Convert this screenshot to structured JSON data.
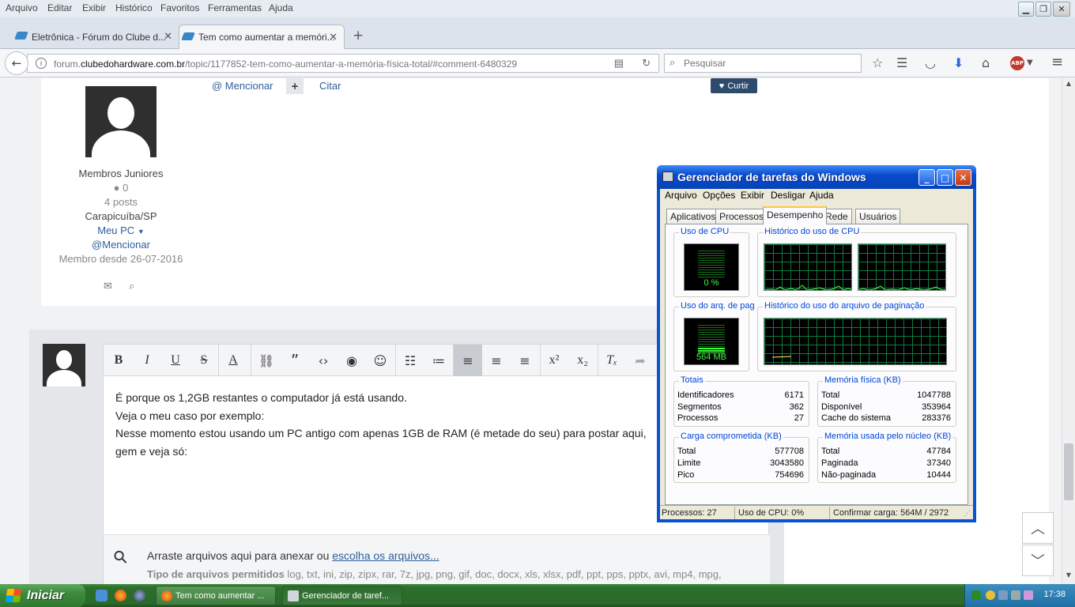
{
  "firefox": {
    "menu": [
      "Arquivo",
      "Editar",
      "Exibir",
      "Histórico",
      "Favoritos",
      "Ferramentas",
      "Ajuda"
    ],
    "tabs": [
      {
        "title": "Eletrônica - Fórum do Clube d...",
        "active": false
      },
      {
        "title": "Tem como aumentar a memóri...",
        "active": true
      }
    ],
    "url_pre": "forum.",
    "url_domain": "clubedohardware.com.br",
    "url_path": "/topic/1177852-tem-como-aumentar-a-memória-física-total/#comment-6480329",
    "search_placeholder": "Pesquisar"
  },
  "post": {
    "mention_action": "@ Mencionar",
    "quote_action": "Citar",
    "like_label": "Curtir",
    "author": {
      "group": "Membros Juniores",
      "reputation": "0",
      "posts": "4 posts",
      "location": "Carapicuíba/SP",
      "my_pc": "Meu PC",
      "mention": "@Mencionar",
      "member_since": "Membro desde 26-07-2016"
    }
  },
  "editor": {
    "lines": [
      "É porque os 1,2GB restantes o computador já está usando.",
      "Veja o meu caso por exemplo:",
      "Nesse momento estou usando um PC antigo com apenas 1GB de RAM (é metade do seu)  para postar aqui,",
      "gem e veja só:"
    ],
    "attach_text": "Arraste arquivos aqui para anexar ou ",
    "attach_link": "escolha os arquivos...",
    "filetypes_label": "Tipo de arquivos permitidos",
    "filetypes": " log, txt, ini, zip, zipx, rar, 7z, jpg, png, gif, doc, docx, xls, xlsx, pdf, ppt, pps, pptx, avi, mp4, mpg,"
  },
  "taskmgr": {
    "title": "Gerenciador de tarefas do Windows",
    "menu": [
      "Arquivo",
      "Opções",
      "Exibir",
      "Desligar",
      "Ajuda"
    ],
    "tabs": [
      "Aplicativos",
      "Processos",
      "Desempenho",
      "Rede",
      "Usuários"
    ],
    "active_tab": "Desempenho",
    "cpu_label": "Uso de CPU",
    "cpu_value": "0 %",
    "cpu_usage": 0,
    "cpu_hist_label": "Histórico do uso de CPU",
    "pf_label": "Uso do arq. de pag",
    "pf_value": "564 MB",
    "pf_usage": 0.19,
    "pf_hist_label": "Histórico do uso do arquivo de paginação",
    "totals": {
      "label": "Totais",
      "rows": [
        {
          "k": "Identificadores",
          "v": "6171"
        },
        {
          "k": "Segmentos",
          "v": "362"
        },
        {
          "k": "Processos",
          "v": "27"
        }
      ]
    },
    "physical": {
      "label": "Memória física (KB)",
      "rows": [
        {
          "k": "Total",
          "v": "1047788"
        },
        {
          "k": "Disponível",
          "v": "353964"
        },
        {
          "k": "Cache do sistema",
          "v": "283376"
        }
      ]
    },
    "commit": {
      "label": "Carga comprometida (KB)",
      "rows": [
        {
          "k": "Total",
          "v": "577708"
        },
        {
          "k": "Limite",
          "v": "3043580"
        },
        {
          "k": "Pico",
          "v": "754696"
        }
      ]
    },
    "kernel": {
      "label": "Memória usada pelo núcleo (KB)",
      "rows": [
        {
          "k": "Total",
          "v": "47784"
        },
        {
          "k": "Paginada",
          "v": "37340"
        },
        {
          "k": "Não-paginada",
          "v": "10444"
        }
      ]
    },
    "status": {
      "processes": "Processos: 27",
      "cpu": "Uso de CPU: 0%",
      "commit": "Confirmar carga: 564M / 2972"
    }
  },
  "taskbar": {
    "start": "Iniciar",
    "tasks": [
      {
        "title": "Tem como aumentar ...",
        "active": false
      },
      {
        "title": "Gerenciador de taref...",
        "active": true
      }
    ],
    "clock": "17:38"
  }
}
